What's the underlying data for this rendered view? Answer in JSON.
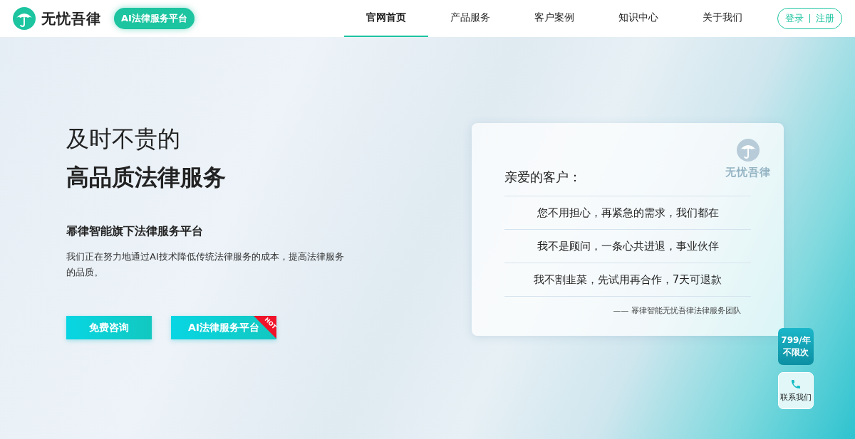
{
  "header": {
    "logo": {
      "text": "无忧吾律",
      "badge": "AI法律服务平台"
    },
    "nav": [
      {
        "label": "官网首页",
        "selected": true
      },
      {
        "label": "产品服务",
        "selected": false
      },
      {
        "label": "客户案例",
        "selected": false
      },
      {
        "label": "知识中心",
        "selected": false
      },
      {
        "label": "关于我们",
        "selected": false
      }
    ],
    "auth": {
      "login": "登录",
      "register": "注册"
    }
  },
  "hero": {
    "title_line1": "及时不贵的",
    "title_line2": "高品质法律服务",
    "subtitle": "幂律智能旗下法律服务平台",
    "description": "我们正在努力地通过AI技术降低传统法律服务的成本，提高法律服务的品质。",
    "buttons": [
      {
        "label": "免费咨询"
      },
      {
        "label": "AI法律服务平台",
        "tag": "HOT"
      }
    ]
  },
  "card": {
    "watermark": "无忧吾律",
    "greeting": "亲爱的客户：",
    "lines": [
      "您不用担心，再紧急的需求，我们都在",
      "我不是顾问，一条心共进退，事业伙伴",
      "我不割韭菜，先试用再合作，7天可退款"
    ],
    "signature": "—— 幂律智能无忧吾律法律服务团队"
  },
  "float": {
    "price": "799/年",
    "price_note": "不限次",
    "contact": "联系我们"
  }
}
